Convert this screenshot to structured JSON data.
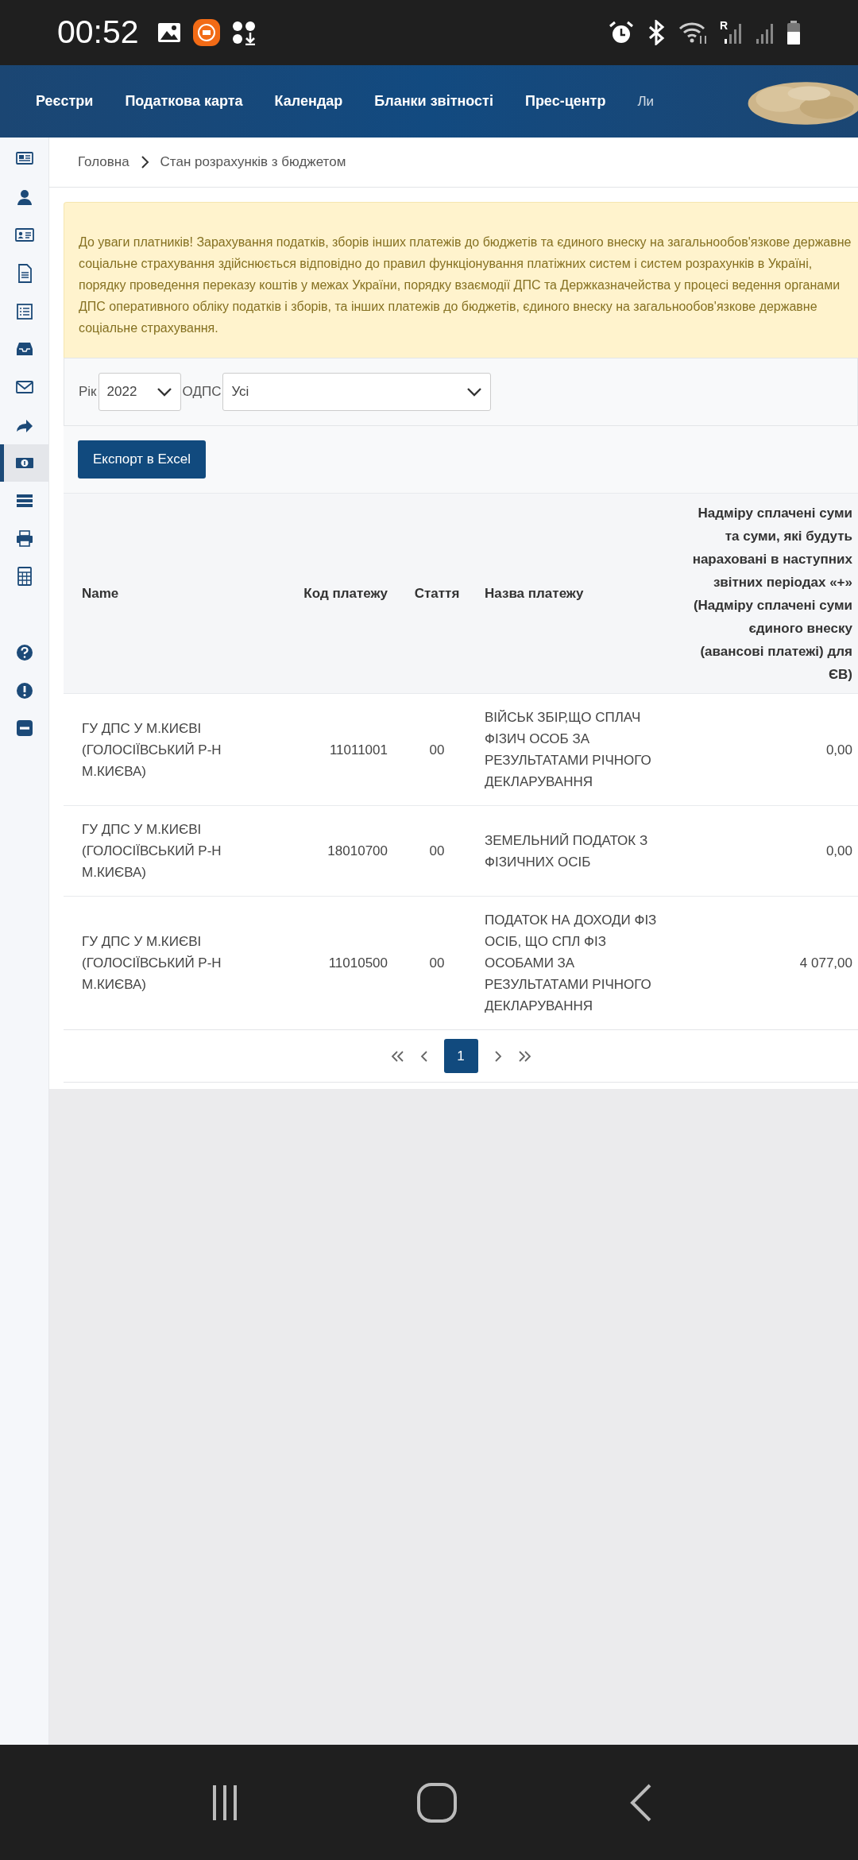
{
  "status_bar": {
    "time": "00:52",
    "network_label": "R"
  },
  "nav": {
    "items": [
      "Реєстри",
      "Податкова карта",
      "Календар",
      "Бланки звітності",
      "Прес-центр",
      "Ли"
    ]
  },
  "sidebar": {
    "top": [
      {
        "selected": false
      },
      {
        "selected": false
      },
      {
        "selected": false
      },
      {
        "selected": false
      },
      {
        "selected": false
      },
      {
        "selected": false
      },
      {
        "selected": false
      },
      {
        "selected": false
      },
      {
        "selected": true
      },
      {
        "selected": false
      },
      {
        "selected": false
      },
      {
        "selected": false
      }
    ],
    "bottom": [
      {
        "selected": false
      },
      {
        "selected": false
      },
      {
        "selected": false
      }
    ]
  },
  "breadcrumb": [
    "Головна",
    "Стан розрахунків з бюджетом"
  ],
  "notice": "До уваги платників! Зарахування податків, зборів інших платежів до бюджетів та єдиного внеску на загальнообов'язкове державне соціальне страхування здійснюється відповідно до правил функціонування платіжних систем і систем розрахунків в Україні, порядку проведення переказу коштів у межах України, порядку взаємодії ДПС та Держказначейства у процесі ведення органами ДПС оперативного обліку податків і зборів, та інших платежів до бюджетів, єдиного внеску на загальнообов'язкове державне соціальне страхування.",
  "filters": [
    {
      "label": "Рік",
      "value": "2022"
    },
    {
      "label": "ОДПС",
      "value": "Усі"
    }
  ],
  "export_button": "Експорт в Excel",
  "table": {
    "columns": [
      "Name",
      "Код платежу",
      "Стаття",
      "Назва платежу",
      "Надміру сплачені суми та суми, які будуть нараховані в наступних звітних періодах «+» (Надміру сплачені суми єдиного внеску (авансові платежі) для ЄВ)"
    ],
    "rows": [
      [
        "ГУ ДПС У М.КИЄВІ (ГОЛОСІЇВСЬКИЙ Р-Н М.КИЄВА)",
        "11011001",
        "00",
        "ВІЙСЬК ЗБІР,ЩО СПЛАЧ ФІЗИЧ ОСОБ ЗА РЕЗУЛЬТАТАМИ РІЧНОГО ДЕКЛАРУВАННЯ",
        "0,00"
      ],
      [
        "ГУ ДПС У М.КИЄВІ (ГОЛОСІЇВСЬКИЙ Р-Н М.КИЄВА)",
        "18010700",
        "00",
        "ЗЕМЕЛЬНИЙ ПОДАТОК З ФІЗИЧНИХ ОСІБ",
        "0,00"
      ],
      [
        "ГУ ДПС У М.КИЄВІ (ГОЛОСІЇВСЬКИЙ Р-Н М.КИЄВА)",
        "11010500",
        "00",
        "ПОДАТОК НА ДОХОДИ ФІЗ ОСІБ, ЩО СПЛ ФІЗ ОСОБАМИ ЗА РЕЗУЛЬТАТАМИ РІЧНОГО ДЕКЛАРУВАННЯ",
        "4 077,00"
      ]
    ]
  },
  "pagination": {
    "pages": [
      {
        "label": "1",
        "selected": true
      }
    ]
  }
}
